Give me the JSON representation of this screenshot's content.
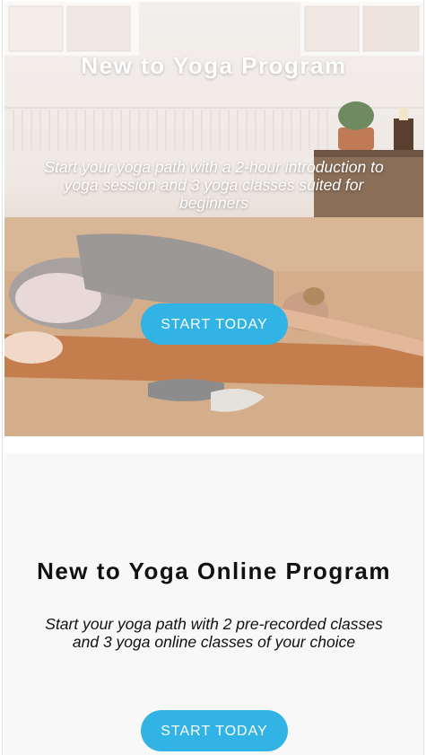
{
  "hero": {
    "title": "New to Yoga Program",
    "subtitle": "Start your yoga path with a 2-hour introduction to yoga session and 3 yoga classes suited for beginners",
    "cta_label": "START TODAY",
    "image_description_icon": "yoga-pose-photo"
  },
  "online": {
    "title": "New to Yoga Online Program",
    "subtitle": "Start your yoga path with 2 pre-recorded classes and 3 yoga online classes of your choice",
    "cta_label": "START TODAY"
  },
  "colors": {
    "accent": "#31b3e6",
    "section_bg": "#f8f8f8",
    "text_dark": "#111111"
  }
}
